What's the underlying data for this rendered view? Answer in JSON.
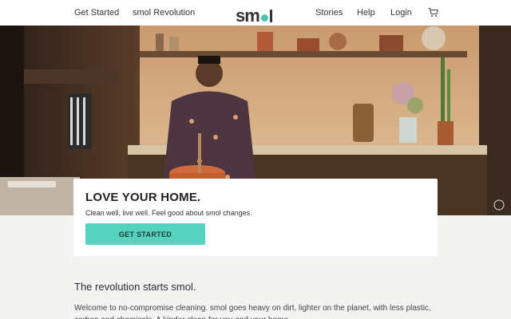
{
  "nav": {
    "left_links": [
      "Get Started",
      "smol Revolution"
    ],
    "logo_text": "sm",
    "right_links": [
      "Stories",
      "Help",
      "Login"
    ],
    "cart_icon": "cart-icon"
  },
  "hero": {
    "title": "LOVE YOUR HOME.",
    "subtitle": "Clean well, live well. Feel good about smol changes.",
    "cta_label": "GET STARTED"
  },
  "main": {
    "heading": "The revolution starts smol.",
    "intro": "Welcome to no-compromise cleaning. smol goes heavy on dirt, lighter on the planet, with less plastic, carbon and chemicals. A kinder clean for you and your home."
  },
  "colors": {
    "accent": "#55d3bf",
    "logo_dot": "#48c1ad",
    "page_bg": "#f3f4f2"
  }
}
